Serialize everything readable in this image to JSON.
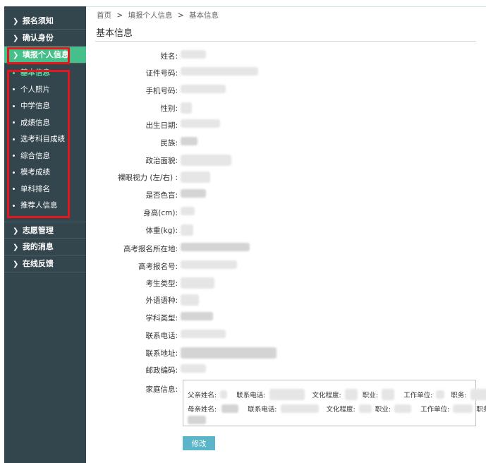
{
  "sidebar": {
    "top_items": [
      {
        "label": "报名须知"
      },
      {
        "label": "确认身份"
      },
      {
        "label": "填报个人信息"
      }
    ],
    "sub_items": [
      {
        "label": "基本信息"
      },
      {
        "label": "个人照片"
      },
      {
        "label": "中学信息"
      },
      {
        "label": "成绩信息"
      },
      {
        "label": "选考科目成绩"
      },
      {
        "label": "综合信息"
      },
      {
        "label": "模考成绩"
      },
      {
        "label": "单科排名"
      },
      {
        "label": "推荐人信息"
      }
    ],
    "bottom_items": [
      {
        "label": "志愿管理"
      },
      {
        "label": "我的消息"
      },
      {
        "label": "在线反馈"
      }
    ]
  },
  "breadcrumb": {
    "home": "首页",
    "sep": ">",
    "section": "填报个人信息",
    "current": "基本信息"
  },
  "page_title": "基本信息",
  "fields": [
    {
      "label": "姓名:"
    },
    {
      "label": "证件号码:"
    },
    {
      "label": "手机号码:"
    },
    {
      "label": "性别:"
    },
    {
      "label": "出生日期:"
    },
    {
      "label": "民族:"
    },
    {
      "label": "政治面貌:"
    },
    {
      "label": "裸眼视力 (左/右) :"
    },
    {
      "label": "是否色盲:"
    },
    {
      "label": "身高(cm):"
    },
    {
      "label": "体重(kg):"
    },
    {
      "label": "高考报名所在地:"
    },
    {
      "label": "高考报名号:"
    },
    {
      "label": "考生类型:"
    },
    {
      "label": "外语语种:"
    },
    {
      "label": "学科类型:"
    },
    {
      "label": "联系电话:"
    },
    {
      "label": "联系地址:"
    },
    {
      "label": "邮政编码:"
    },
    {
      "label": "家庭信息:"
    }
  ],
  "family": {
    "father": {
      "name_label": "父亲姓名:",
      "phone_label": "联系电话:",
      "edu_label": "文化程度:",
      "job_label": "职业:",
      "work_label": "工作单位:",
      "title_label": "职务:"
    },
    "mother": {
      "name_label": "母亲姓名:",
      "phone_label": "联系电话:",
      "edu_label": "文化程度:",
      "job_label": "职业:",
      "work_label": "工作单位:",
      "title_label": "职务:"
    }
  },
  "buttons": {
    "edit": "修改"
  },
  "colors": {
    "sidebar_bg": "#33454d",
    "active_bg": "#46c08a",
    "highlight_border": "#e8161c",
    "current_sub": "#5de0a8",
    "button_bg": "#5ab5c9"
  },
  "icons": {
    "nav_chevron": "chevron-right-icon",
    "sub_bullet": "bullet-dot-icon"
  }
}
